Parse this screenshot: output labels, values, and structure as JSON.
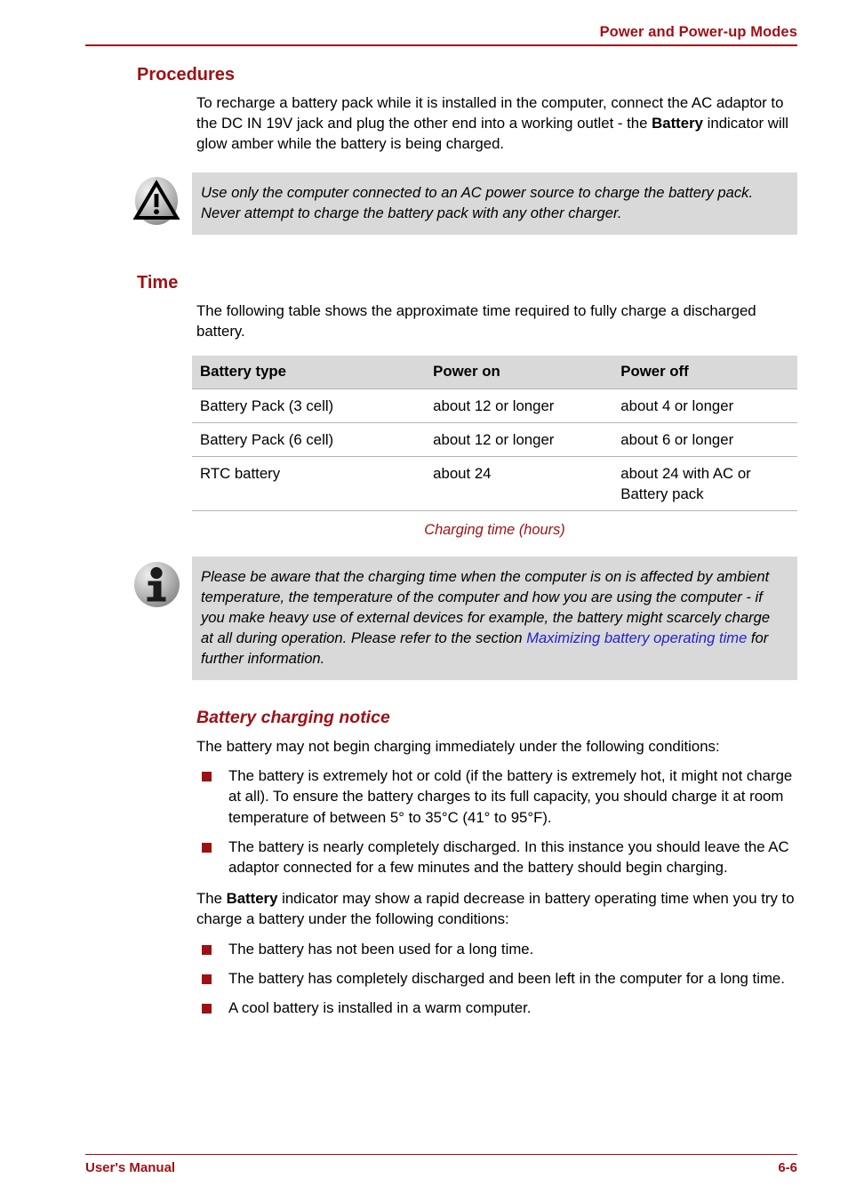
{
  "header": {
    "title": "Power and Power-up Modes"
  },
  "footer": {
    "manual_label": "User's Manual",
    "page_number": "6-6"
  },
  "colors": {
    "accent_red": "#9e1014",
    "link_blue": "#2222cc",
    "note_bg": "#d9d9d9",
    "table_header_bg": "#d9d9d9",
    "rule_gray": "#b4b4b4"
  },
  "sections": {
    "procedures": {
      "heading": "Procedures",
      "paragraph": "To recharge a battery pack while it is installed in the computer, connect the AC adaptor to the DC IN 19V jack and plug the other end into a working outlet - the ",
      "paragraph_bold": "Battery",
      "paragraph_tail": " indicator will glow amber while the battery is being charged."
    },
    "caution": {
      "icon": "warning-triangle-icon",
      "text": "Use only the computer connected to an AC power source to charge the battery pack. Never attempt to charge the battery pack with any other charger."
    },
    "time": {
      "heading": "Time",
      "paragraph": "The following table shows the approximate time required to fully charge a discharged battery.",
      "table": {
        "headers": [
          "Battery type",
          "Power on",
          "Power off"
        ],
        "rows": [
          [
            "Battery Pack (3 cell)",
            "about 12 or longer",
            "about 4 or longer"
          ],
          [
            "Battery Pack (6 cell)",
            "about 12 or longer",
            "about 6 or longer"
          ],
          [
            "RTC battery",
            "about 24",
            "about 24 with AC or Battery pack"
          ]
        ],
        "caption": "Charging time (hours)"
      }
    },
    "info_note": {
      "icon": "info-icon",
      "text_before_link": "Please be aware that the charging time when the computer is on is affected by ambient temperature, the temperature of the computer and how you are using the computer - if you make heavy use of external devices for example, the battery might scarcely charge at all during operation. Please refer to the section ",
      "link_text": "Maximizing battery operating time",
      "text_after_link": " for further information."
    },
    "battery_charging_notice": {
      "heading": "Battery charging notice",
      "intro": "The battery may not begin charging immediately under the following conditions:",
      "bullets": [
        "The battery is extremely hot or cold (if the battery is extremely hot, it might not charge at all). To ensure the battery charges to its full capacity, you should charge it at room temperature of between 5° to 35°C (41° to 95°F).",
        "The battery is nearly completely discharged. In this instance you should leave the AC adaptor connected for a few minutes and the battery should begin charging."
      ],
      "second_paragraph_before": "The ",
      "second_paragraph_bold": "Battery",
      "second_paragraph_after": " indicator may show a rapid decrease in battery operating time when you try to charge a battery under the following conditions:",
      "bullets2": [
        "The battery has not been used for a long time.",
        "The battery has completely discharged and been left in the computer for a long time.",
        "A cool battery is installed in a warm computer."
      ]
    }
  }
}
